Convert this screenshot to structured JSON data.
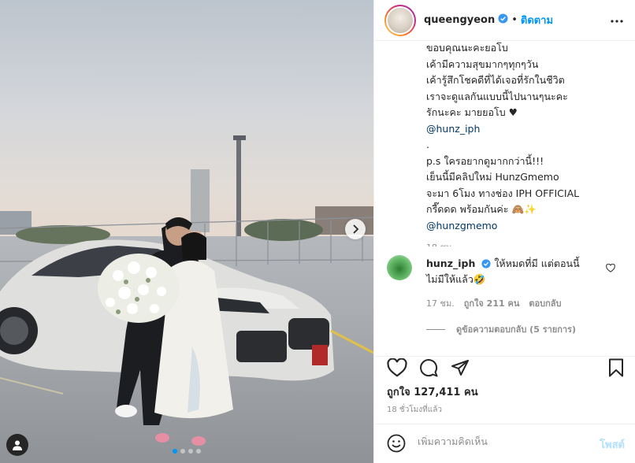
{
  "colors": {
    "accent": "#0095f6",
    "mention": "#00376b",
    "muted": "#8e8e8e",
    "text": "#262626"
  },
  "post": {
    "username": "queengyeon",
    "follow_label": "ติดตาม",
    "caption_lines": [
      "ขอบคุณนะคะยอโบ",
      "เค้ามีความสุขมากๆทุกๆวัน",
      "เค้ารู้สึกโชคดีที่ได้เจอที่รักในชีวิต",
      "เราจะดูแลกันแบบนี้ไปนานๆนะคะ",
      "รักนะคะ มายยอโบ ♥",
      "@hunz_iph",
      ".",
      "p.s ใครอยากดูมากกว่านี้!!!",
      "เย็นนี้มีคลิปใหม่ HunzGmemo",
      "จะมา 6โมง ทางช่อง IPH OFFICIAL",
      "กรี๊ดดด พร้อมกันค่ะ 🙈✨",
      "@hunzgmemo"
    ],
    "caption_time": "18 ชม.",
    "likes_label": "ถูกใจ",
    "likes_count": "127,411",
    "likes_unit": "คน",
    "posted_ago": "18 ชั่วโมงที่แล้ว",
    "carousel_dots": 4,
    "carousel_active": 1
  },
  "comment": {
    "username": "hunz_iph",
    "text_line1": "ให้หมดที่มี แต่ตอนนี้",
    "text_line2": "ไม่มีให้แล้ว🤣",
    "time": "17 ชม.",
    "likes": "ถูกใจ 211 คน",
    "reply": "ตอบกลับ",
    "view_replies": "ดูข้อความตอบกลับ (5 รายการ)"
  },
  "add_comment": {
    "placeholder": "เพิ่มความคิดเห็น",
    "post_label": "โพสต์"
  }
}
